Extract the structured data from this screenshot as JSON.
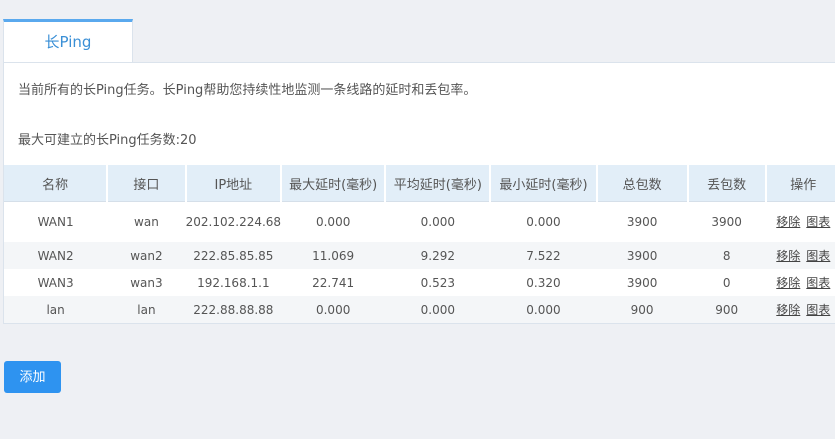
{
  "tab": {
    "label": "长Ping"
  },
  "description": "当前所有的长Ping任务。长Ping帮助您持续性地监测一条线路的延时和丢包率。",
  "max_tasks_text": "最大可建立的长Ping任务数:20",
  "table": {
    "headers": [
      "名称",
      "接口",
      "IP地址",
      "最大延时(毫秒)",
      "平均延时(毫秒)",
      "最小延时(毫秒)",
      "总包数",
      "丢包数",
      "操作"
    ],
    "rows": [
      {
        "name": "WAN1",
        "iface": "wan",
        "ip": "202.102.224.68",
        "max": "0.000",
        "avg": "0.000",
        "min": "0.000",
        "total": "3900",
        "lost": "3900",
        "remove": "移除",
        "chart": "图表"
      },
      {
        "name": "WAN2",
        "iface": "wan2",
        "ip": "222.85.85.85",
        "max": "11.069",
        "avg": "9.292",
        "min": "7.522",
        "total": "3900",
        "lost": "8",
        "remove": "移除",
        "chart": "图表"
      },
      {
        "name": "WAN3",
        "iface": "wan3",
        "ip": "192.168.1.1",
        "max": "22.741",
        "avg": "0.523",
        "min": "0.320",
        "total": "3900",
        "lost": "0",
        "remove": "移除",
        "chart": "图表"
      },
      {
        "name": "lan",
        "iface": "lan",
        "ip": "222.88.88.88",
        "max": "0.000",
        "avg": "0.000",
        "min": "0.000",
        "total": "900",
        "lost": "900",
        "remove": "移除",
        "chart": "图表"
      }
    ]
  },
  "add_button": "添加"
}
